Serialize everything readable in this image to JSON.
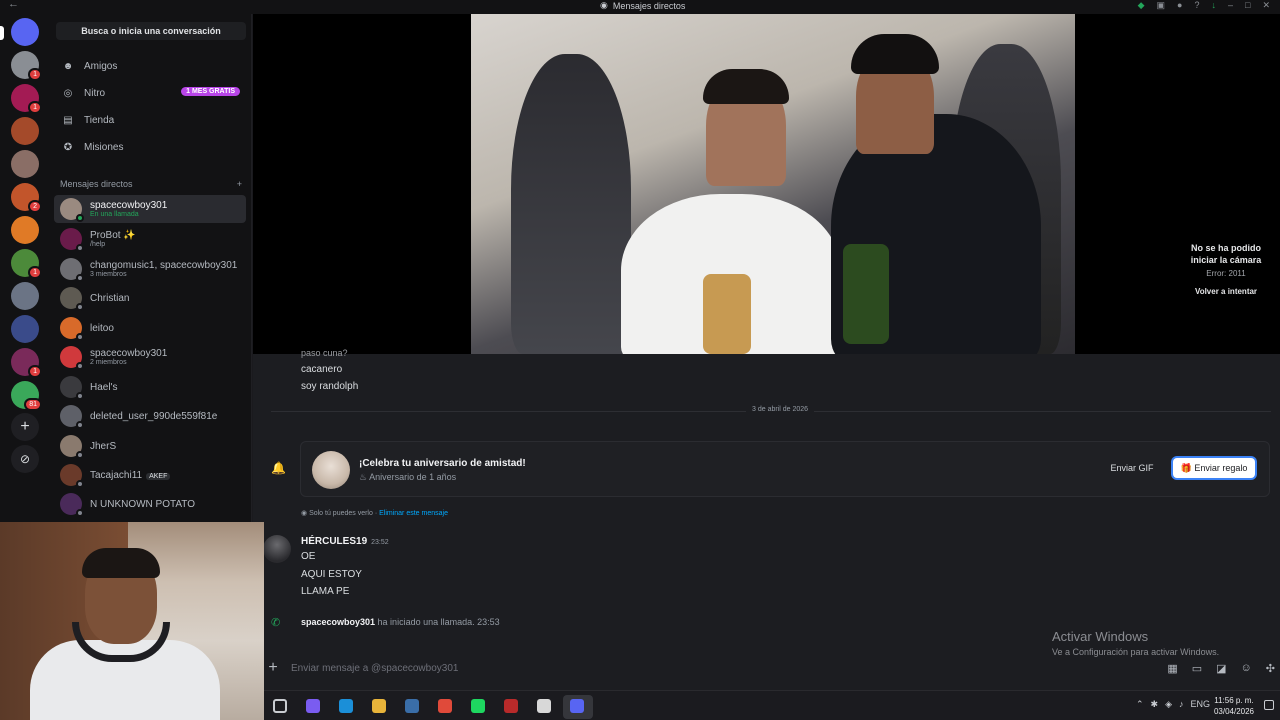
{
  "window": {
    "title": "Mensajes directos"
  },
  "servers": [
    {
      "color": "#5865f2",
      "badge": ""
    },
    {
      "color": "#8a8e94",
      "badge": "1"
    },
    {
      "color": "#a31b54",
      "badge": "1"
    },
    {
      "color": "#a44a2a",
      "badge": ""
    },
    {
      "color": "#8a6e66",
      "badge": ""
    },
    {
      "color": "#c2552b",
      "badge": "2"
    },
    {
      "color": "#e07a26",
      "badge": ""
    },
    {
      "color": "#4c8a3a",
      "badge": "1"
    },
    {
      "color": "#6b7485",
      "badge": ""
    },
    {
      "color": "#3a4b8a",
      "badge": ""
    },
    {
      "color": "#7a2a5a",
      "badge": "1"
    },
    {
      "color": "#3aa85a",
      "badge": "81"
    }
  ],
  "sidebar": {
    "search_label": "Busca o inicia una conversación",
    "nav": [
      {
        "label": "Amigos",
        "icon": "friends-icon"
      },
      {
        "label": "Nitro",
        "icon": "nitro-icon",
        "badge": "1 MES GRATIS"
      },
      {
        "label": "Tienda",
        "icon": "shop-icon"
      },
      {
        "label": "Misiones",
        "icon": "quests-icon"
      }
    ],
    "dm_header": "Mensajes directos",
    "dms": [
      {
        "name": "spacecowboy301",
        "sub": "En una llamada",
        "color": "#9a8a80"
      },
      {
        "name": "ProBot ✨",
        "sub": "/help",
        "color": "#6a1b4a"
      },
      {
        "name": "changomusic1, spacecowboy301",
        "sub": "3 miembros",
        "color": "#6e6e73"
      },
      {
        "name": "Christian",
        "sub": "",
        "color": "#5e5a52"
      },
      {
        "name": "leitoo",
        "sub": "",
        "color": "#d86a2a"
      },
      {
        "name": "spacecowboy301",
        "sub": "2 miembros",
        "color": "#d0393c"
      },
      {
        "name": "Hael's",
        "sub": "",
        "color": "#3a3a3e"
      },
      {
        "name": "deleted_user_990de559f81e",
        "sub": "",
        "color": "#5e6068"
      },
      {
        "name": "JherS",
        "sub": "",
        "color": "#8a7a6e"
      },
      {
        "name": "Tacajachi11",
        "sub": "",
        "tag": "AKEF",
        "color": "#6a3a2a"
      },
      {
        "name": "N UNKNOWN POTATO",
        "sub": "",
        "color": "#4a2a5a"
      }
    ]
  },
  "call": {
    "error_title": "No se ha podido iniciar la cámara",
    "error_code": "Error: 2011",
    "retry_label": "Volver a intentar"
  },
  "chat": {
    "prev_lines": [
      "paso cuna?",
      "cacanero",
      "soy randolph"
    ],
    "date_divider": "3 de abril de 2026",
    "anniversary": {
      "title": "¡Celebra tu aniversario de amistad!",
      "subtitle": "Aniversario de 1 años",
      "gif_label": "Enviar GIF",
      "gift_label": "Enviar regalo"
    },
    "only_you": "Solo tú puedes verlo · ",
    "delete_label": "Eliminar este mensaje",
    "message": {
      "author": "HÉRCULES19",
      "time": "23:52",
      "lines": [
        "OE",
        "AQUI ESTOY",
        "LLAMA PE"
      ]
    },
    "call_event": {
      "user": "spacecowboy301",
      "text": " ha iniciado una llamada.",
      "time": "23:53"
    },
    "composer_placeholder": "Enviar mensaje a @spacecowboy301"
  },
  "watermark": {
    "title": "Activar Windows",
    "subtitle": "Ve a Configuración para activar Windows."
  },
  "taskbar": {
    "lang": "ENG",
    "time": "11:56 p. m.",
    "date": "03/04/2026",
    "apps": [
      {
        "icon": "task-view-icon",
        "color": "#c9ccd1"
      },
      {
        "icon": "copilot-icon",
        "color": "#7a5cf0"
      },
      {
        "icon": "edge-icon",
        "color": "#1b8fd8"
      },
      {
        "icon": "files-icon",
        "color": "#e8b43a"
      },
      {
        "icon": "steam-icon",
        "color": "#3a6ea8"
      },
      {
        "icon": "chrome-icon",
        "color": "#e04a3a"
      },
      {
        "icon": "spotify-icon",
        "color": "#1ed760"
      },
      {
        "icon": "app-red-icon",
        "color": "#b82a2a"
      },
      {
        "icon": "obs-icon",
        "color": "#d8d8d8"
      },
      {
        "icon": "discord-icon",
        "color": "#5865f2"
      }
    ]
  }
}
